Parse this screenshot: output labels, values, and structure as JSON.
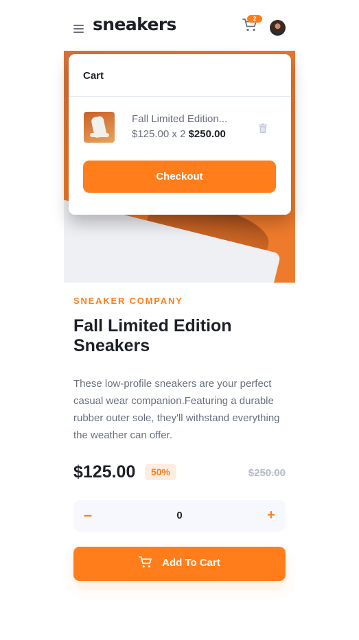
{
  "header": {
    "logo": "sneakers",
    "cart_count": "2",
    "icons": [
      "menu-icon",
      "cart-icon",
      "avatar"
    ]
  },
  "cart": {
    "title": "Cart",
    "item": {
      "name": "Fall Limited Edition...",
      "unit_price": "$125.00",
      "quantity_text": "x 2",
      "total": "$250.00"
    },
    "checkout_label": "Checkout"
  },
  "product": {
    "company": "SNEAKER COMPANY",
    "title": "Fall Limited Edition Sneakers",
    "description": "These low-profile sneakers are your perfect casual wear companion.Featuring a durable rubber outer sole, they'll withstand everything the weather can offer.",
    "price": "$125.00",
    "discount": "50%",
    "old_price": "$250.00"
  },
  "quantity": {
    "minus": "–",
    "value": "0",
    "plus": "+"
  },
  "add_to_cart": {
    "label": "Add To Cart"
  },
  "colors": {
    "accent": "#ff7e1b",
    "accent_pale": "#ffede0",
    "text_dark": "#1d2026",
    "text_muted": "#69707d"
  }
}
